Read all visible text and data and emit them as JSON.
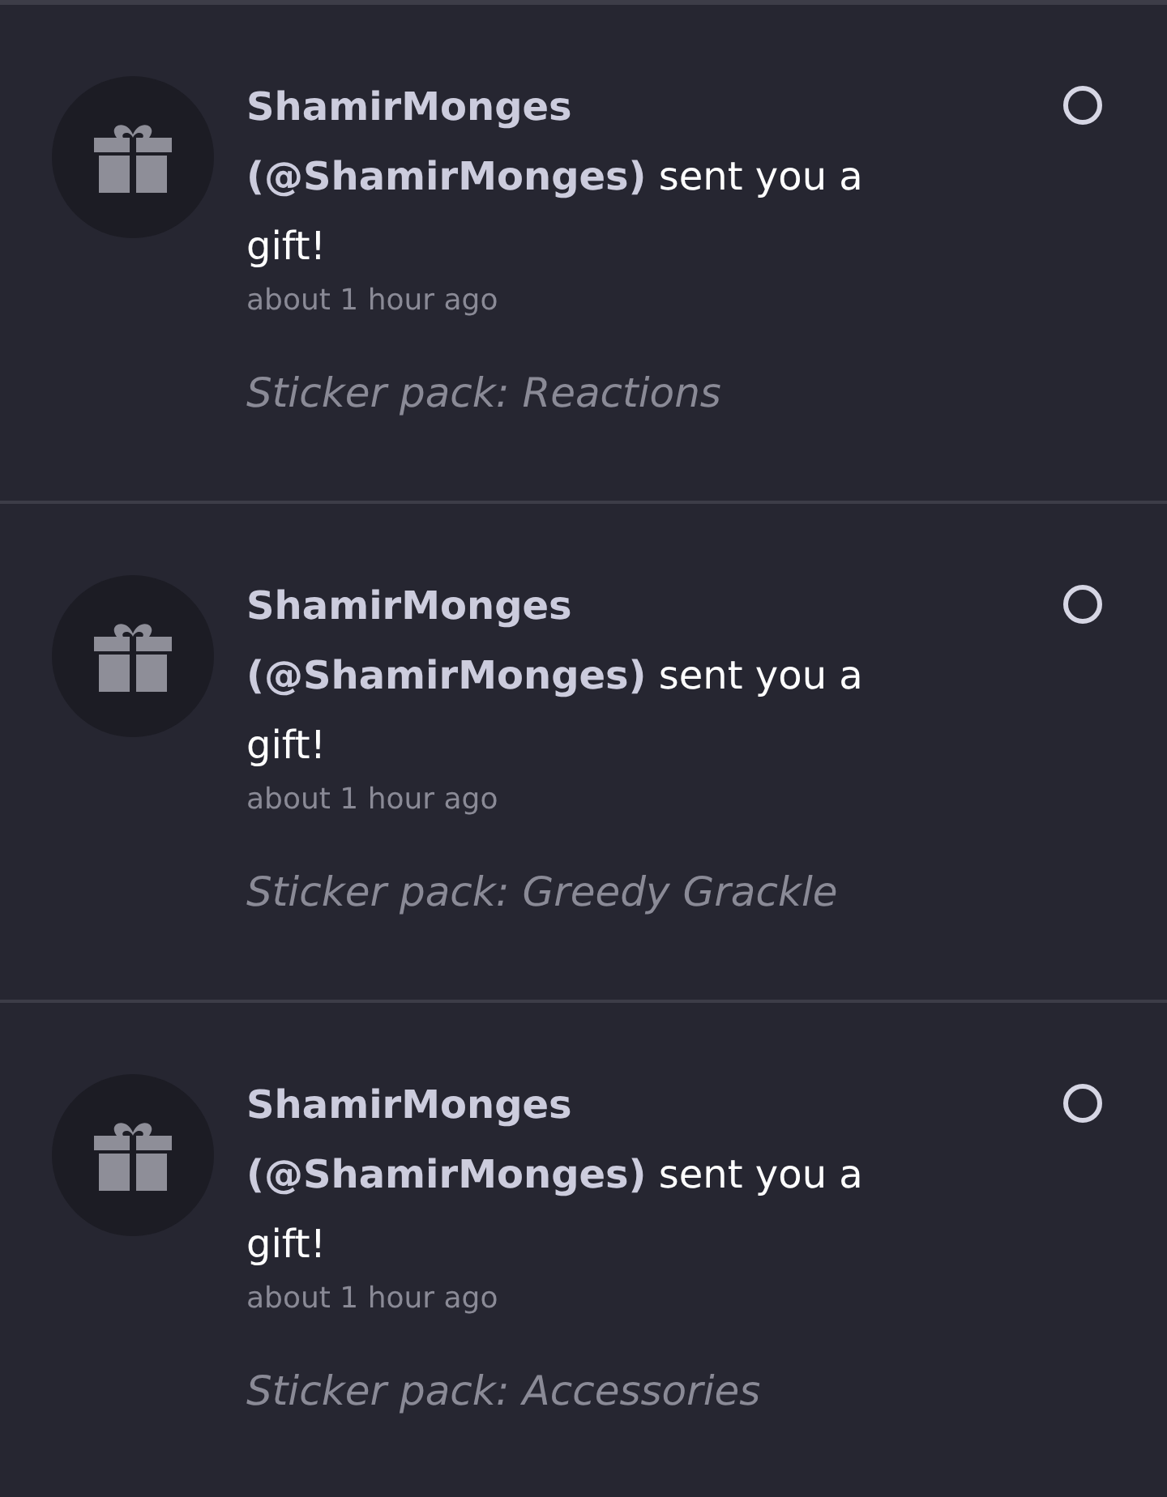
{
  "notifications": [
    {
      "message": "**ShamirMonges (@ShamirMonges)** sent you a gift!",
      "time": "about 1 hour ago",
      "detail": "Sticker pack: Reactions",
      "read": false
    },
    {
      "message": "**ShamirMonges (@ShamirMonges)** sent you a gift!",
      "time": "about 1 hour ago",
      "detail": "Sticker pack: Greedy Grackle",
      "read": false
    },
    {
      "message": "**ShamirMonges (@ShamirMonges)** sent you a gift!",
      "time": "about 1 hour ago",
      "detail": "Sticker pack: Accessories",
      "read": false
    }
  ]
}
